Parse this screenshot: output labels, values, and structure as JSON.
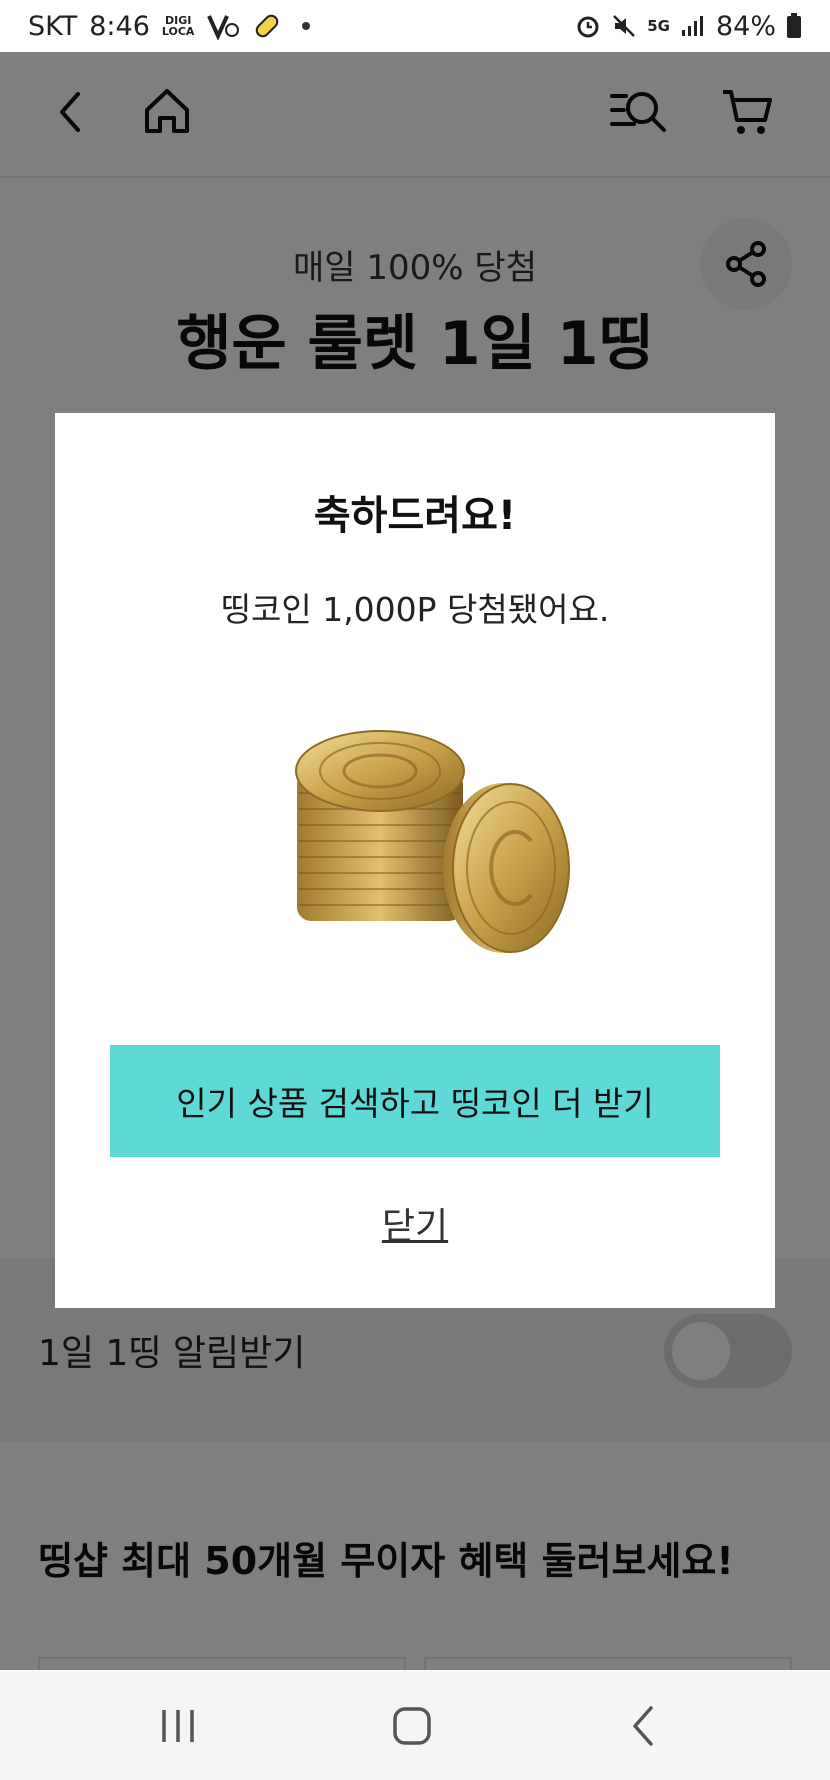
{
  "status_bar": {
    "carrier": "SKT",
    "time": "8:46",
    "digi_top": "DIGI",
    "digi_bottom": "LOCA",
    "network": "5G",
    "battery": "84%"
  },
  "header": {
    "subtitle": "매일 100% 당첨",
    "title": "행운 룰렛 1일 1띵"
  },
  "alarm": {
    "label": "1일 1띵 알림받기",
    "enabled": false
  },
  "promo": {
    "title": "띵샵 최대 50개월 무이자 혜택 둘러보세요!"
  },
  "modal": {
    "title": "축하드려요!",
    "message": "띵코인 1,000P 당첨됐어요.",
    "cta_label": "인기 상품 검색하고 띵코인 더 받기",
    "close_label": "닫기"
  },
  "colors": {
    "accent": "#5ed9d8",
    "overlay": "rgba(0,0,0,0.5)",
    "coin": "#c9a24a"
  },
  "icons": [
    "back-icon",
    "home-icon",
    "search-menu-icon",
    "cart-icon",
    "share-icon",
    "recent-apps-icon",
    "home-nav-icon",
    "back-nav-icon"
  ]
}
